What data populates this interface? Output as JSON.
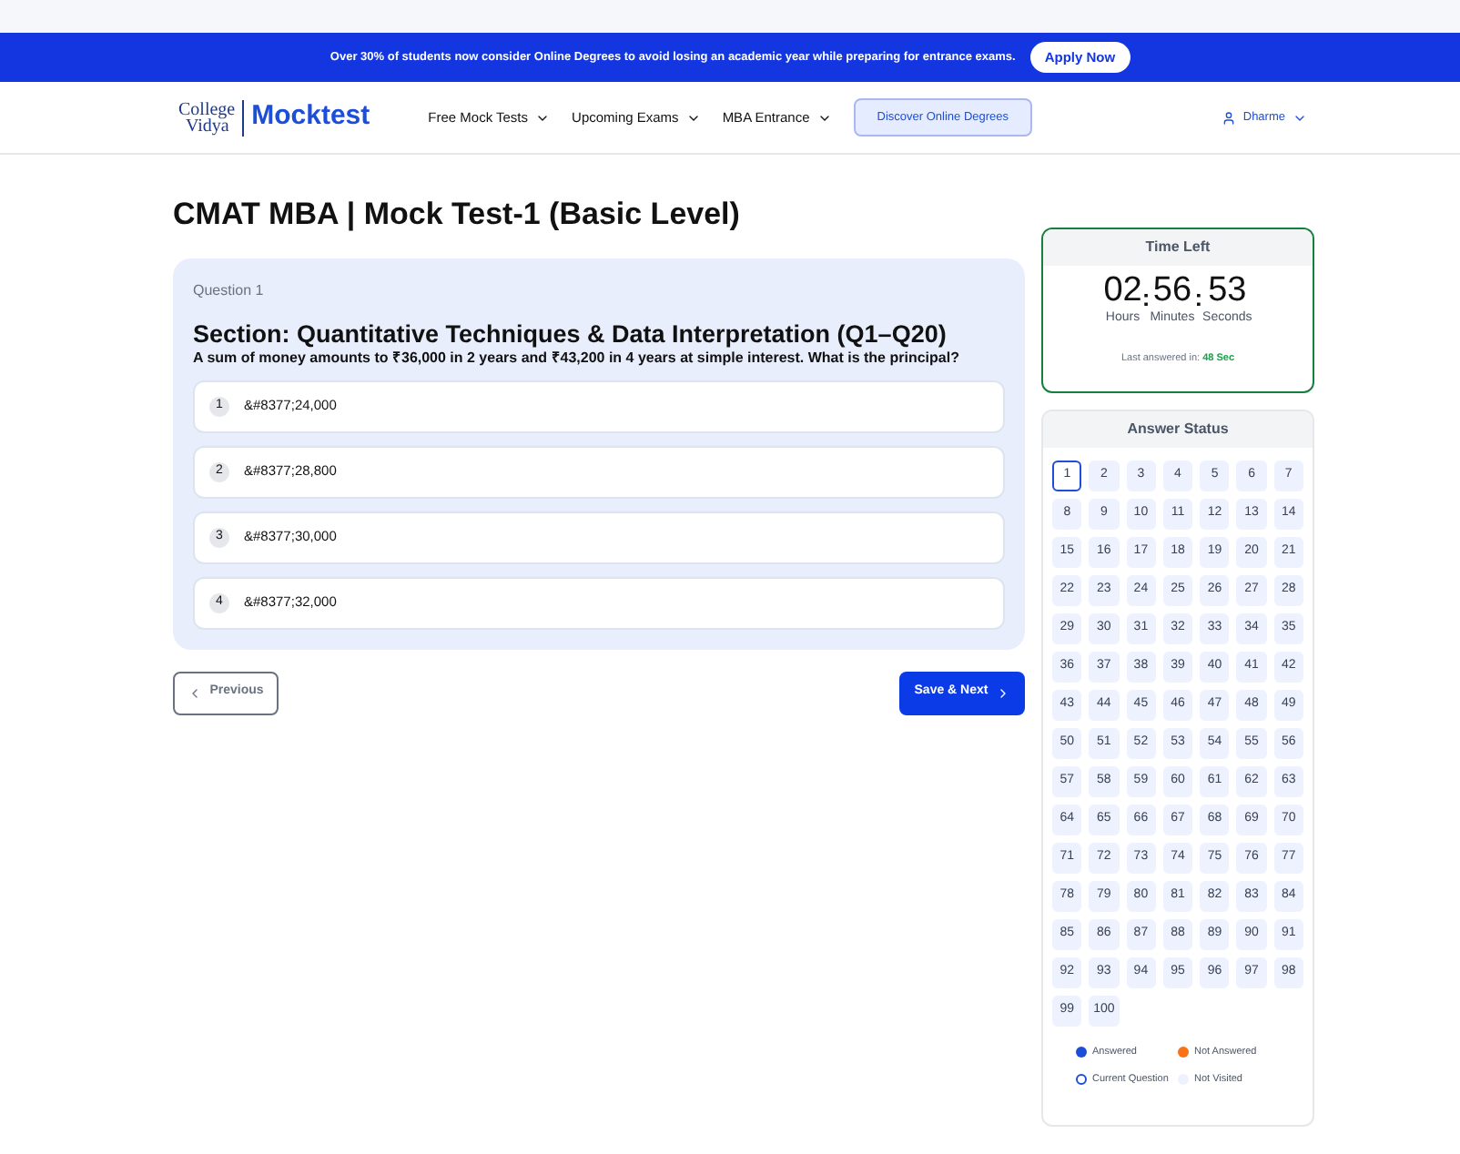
{
  "banner": {
    "text": "Over 30% of students now consider Online Degrees to avoid losing an academic year while preparing for entrance exams.",
    "button": "Apply Now"
  },
  "nav": {
    "logo_top": "College",
    "logo_bottom": "Vidya",
    "brand": "Mocktest",
    "menus": [
      "Free Mock Tests",
      "Upcoming Exams",
      "MBA Entrance"
    ],
    "cta": "Discover Online Degrees",
    "user": "Dharme"
  },
  "title": "CMAT MBA | Mock Test-1 (Basic Level)",
  "question": {
    "number_label": "Question 1",
    "section": "Section: Quantitative Techniques & Data Interpretation (Q1–Q20)",
    "text": "A sum of money amounts to ₹36,000 in 2 years and ₹43,200 in 4 years at simple interest. What is the principal?",
    "options": [
      {
        "index": "1",
        "text": "&#8377;24,000",
        "selected": false
      },
      {
        "index": "2",
        "text": "&#8377;28,800",
        "selected": false
      },
      {
        "index": "3",
        "text": "&#8377;30,000",
        "selected": false
      },
      {
        "index": "4",
        "text": "&#8377;32,000",
        "selected": false
      }
    ]
  },
  "buttons": {
    "previous": "Previous",
    "next": "Save & Next"
  },
  "timer": {
    "title": "Time Left",
    "hours": "02",
    "minutes": "56",
    "seconds": "53",
    "hours_label": "Hours",
    "minutes_label": "Minutes",
    "seconds_label": "Seconds",
    "sep": ":",
    "last_label": "Last answered in:",
    "last_value": "48 Sec"
  },
  "answer_status": {
    "title": "Answer Status",
    "questions": [
      {
        "label": "1",
        "selected": true
      },
      {
        "label": "2",
        "selected": false
      },
      {
        "label": "3",
        "selected": false
      },
      {
        "label": "4",
        "selected": false
      },
      {
        "label": "5",
        "selected": false
      },
      {
        "label": "6",
        "selected": false
      },
      {
        "label": "7",
        "selected": false
      },
      {
        "label": "8",
        "selected": false
      },
      {
        "label": "9",
        "selected": false
      },
      {
        "label": "10",
        "selected": false
      },
      {
        "label": "11",
        "selected": false
      },
      {
        "label": "12",
        "selected": false
      },
      {
        "label": "13",
        "selected": false
      },
      {
        "label": "14",
        "selected": false
      },
      {
        "label": "15",
        "selected": false
      },
      {
        "label": "16",
        "selected": false
      },
      {
        "label": "17",
        "selected": false
      },
      {
        "label": "18",
        "selected": false
      },
      {
        "label": "19",
        "selected": false
      },
      {
        "label": "20",
        "selected": false
      },
      {
        "label": "21",
        "selected": false
      },
      {
        "label": "22",
        "selected": false
      },
      {
        "label": "23",
        "selected": false
      },
      {
        "label": "24",
        "selected": false
      },
      {
        "label": "25",
        "selected": false
      },
      {
        "label": "26",
        "selected": false
      },
      {
        "label": "27",
        "selected": false
      },
      {
        "label": "28",
        "selected": false
      },
      {
        "label": "29",
        "selected": false
      },
      {
        "label": "30",
        "selected": false
      },
      {
        "label": "31",
        "selected": false
      },
      {
        "label": "32",
        "selected": false
      },
      {
        "label": "33",
        "selected": false
      },
      {
        "label": "34",
        "selected": false
      },
      {
        "label": "35",
        "selected": false
      },
      {
        "label": "36",
        "selected": false
      },
      {
        "label": "37",
        "selected": false
      },
      {
        "label": "38",
        "selected": false
      },
      {
        "label": "39",
        "selected": false
      },
      {
        "label": "40",
        "selected": false
      },
      {
        "label": "41",
        "selected": false
      },
      {
        "label": "42",
        "selected": false
      },
      {
        "label": "43",
        "selected": false
      },
      {
        "label": "44",
        "selected": false
      },
      {
        "label": "45",
        "selected": false
      },
      {
        "label": "46",
        "selected": false
      },
      {
        "label": "47",
        "selected": false
      },
      {
        "label": "48",
        "selected": false
      },
      {
        "label": "49",
        "selected": false
      },
      {
        "label": "50",
        "selected": false
      },
      {
        "label": "51",
        "selected": false
      },
      {
        "label": "52",
        "selected": false
      },
      {
        "label": "53",
        "selected": false
      },
      {
        "label": "54",
        "selected": false
      },
      {
        "label": "55",
        "selected": false
      },
      {
        "label": "56",
        "selected": false
      },
      {
        "label": "57",
        "selected": false
      },
      {
        "label": "58",
        "selected": false
      },
      {
        "label": "59",
        "selected": false
      },
      {
        "label": "60",
        "selected": false
      },
      {
        "label": "61",
        "selected": false
      },
      {
        "label": "62",
        "selected": false
      },
      {
        "label": "63",
        "selected": false
      },
      {
        "label": "64",
        "selected": false
      },
      {
        "label": "65",
        "selected": false
      },
      {
        "label": "66",
        "selected": false
      },
      {
        "label": "67",
        "selected": false
      },
      {
        "label": "68",
        "selected": false
      },
      {
        "label": "69",
        "selected": false
      },
      {
        "label": "70",
        "selected": false
      },
      {
        "label": "71",
        "selected": false
      },
      {
        "label": "72",
        "selected": false
      },
      {
        "label": "73",
        "selected": false
      },
      {
        "label": "74",
        "selected": false
      },
      {
        "label": "75",
        "selected": false
      },
      {
        "label": "76",
        "selected": false
      },
      {
        "label": "77",
        "selected": false
      },
      {
        "label": "78",
        "selected": false
      },
      {
        "label": "79",
        "selected": false
      },
      {
        "label": "80",
        "selected": false
      },
      {
        "label": "81",
        "selected": false
      },
      {
        "label": "82",
        "selected": false
      },
      {
        "label": "83",
        "selected": false
      },
      {
        "label": "84",
        "selected": false
      },
      {
        "label": "85",
        "selected": false
      },
      {
        "label": "86",
        "selected": false
      },
      {
        "label": "87",
        "selected": false
      },
      {
        "label": "88",
        "selected": false
      },
      {
        "label": "89",
        "selected": false
      },
      {
        "label": "90",
        "selected": false
      },
      {
        "label": "91",
        "selected": false
      },
      {
        "label": "92",
        "selected": false
      },
      {
        "label": "93",
        "selected": false
      },
      {
        "label": "94",
        "selected": false
      },
      {
        "label": "95",
        "selected": false
      },
      {
        "label": "96",
        "selected": false
      },
      {
        "label": "97",
        "selected": false
      },
      {
        "label": "98",
        "selected": false
      },
      {
        "label": "99",
        "selected": false
      },
      {
        "label": "100",
        "selected": false
      }
    ],
    "legend": [
      {
        "kind": "filled",
        "label": "Answered",
        "color": "#1d4ed8"
      },
      {
        "kind": "filled",
        "label": "Not Answered",
        "color": "#f97316"
      },
      {
        "kind": "outline",
        "label": "Current Question",
        "color": "#1d4ed8"
      },
      {
        "kind": "filled",
        "label": "Not Visited",
        "color": "#eef2ff"
      }
    ]
  }
}
